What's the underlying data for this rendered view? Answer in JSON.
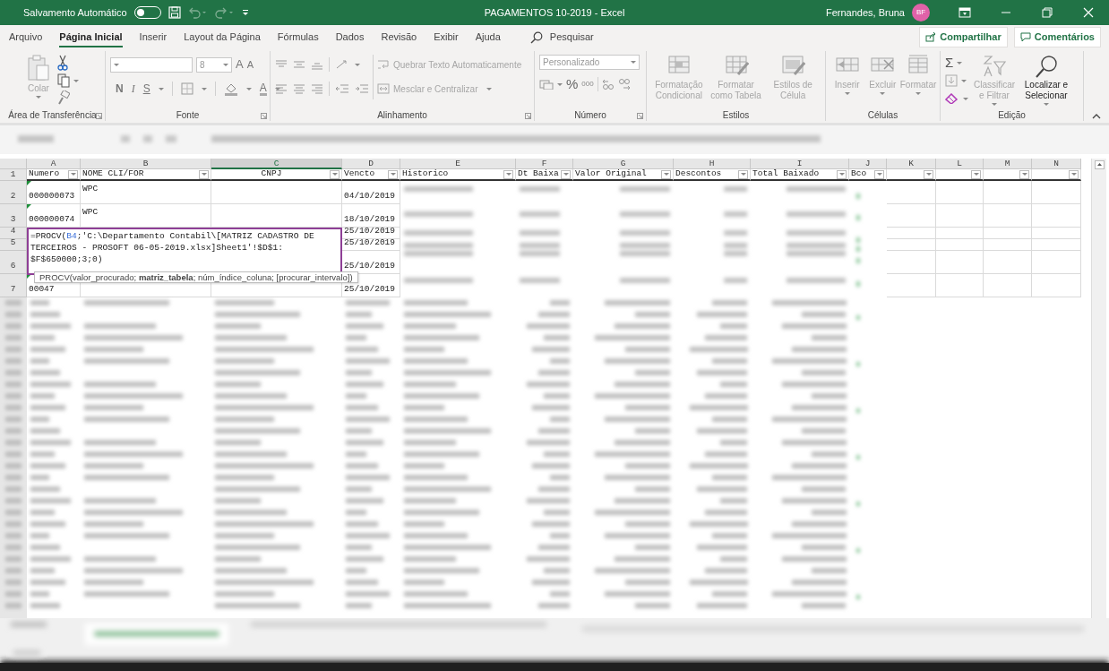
{
  "title_bar": {
    "autosave_label": "Salvamento Automático",
    "autosave_on": false,
    "document_title": "PAGAMENTOS 10-2019  -  Excel",
    "user_name": "Fernandes, Bruna",
    "user_initials": "BF"
  },
  "ribbon_tabs": [
    {
      "label": "Arquivo",
      "selected": false
    },
    {
      "label": "Página Inicial",
      "selected": true
    },
    {
      "label": "Inserir",
      "selected": false
    },
    {
      "label": "Layout da Página",
      "selected": false
    },
    {
      "label": "Fórmulas",
      "selected": false
    },
    {
      "label": "Dados",
      "selected": false
    },
    {
      "label": "Revisão",
      "selected": false
    },
    {
      "label": "Exibir",
      "selected": false
    },
    {
      "label": "Ajuda",
      "selected": false
    }
  ],
  "search_label": "Pesquisar",
  "share_button": "Compartilhar",
  "comments_button": "Comentários",
  "ribbon": {
    "clipboard": {
      "name": "Área de Transferência",
      "paste_label": "Colar"
    },
    "font": {
      "name": "Fonte",
      "font_size": "8",
      "size_glyphs": [
        "A",
        "A"
      ],
      "style_buttons": [
        "N",
        "I",
        "S"
      ],
      "color_glyph": "A"
    },
    "alignment": {
      "name": "Alinhamento",
      "wrap_label": "Quebrar Texto Automaticamente",
      "merge_label": "Mesclar e Centralizar"
    },
    "number": {
      "name": "Número",
      "format": "Personalizado",
      "percent": "%",
      "thousands": "000"
    },
    "styles": {
      "name": "Estilos",
      "buttons": [
        {
          "label": "Formatação Condicional",
          "kind": "conditional",
          "disabled": true
        },
        {
          "label": "Formatar como Tabela",
          "kind": "table",
          "disabled": true
        },
        {
          "label": "Estilos de Célula",
          "kind": "cellstyle",
          "disabled": true
        }
      ]
    },
    "cells": {
      "name": "Células",
      "buttons": [
        {
          "label": "Inserir",
          "kind": "insert",
          "disabled": true
        },
        {
          "label": "Excluir",
          "kind": "delete",
          "disabled": true
        },
        {
          "label": "Formatar",
          "kind": "format",
          "disabled": true
        }
      ]
    },
    "editing": {
      "name": "Edição",
      "sum_glyph": "Σ",
      "buttons": [
        {
          "label": "Classificar e Filtrar",
          "kind": "sort",
          "disabled": true
        },
        {
          "label": "Localizar e Selecionar",
          "kind": "find",
          "disabled": false
        }
      ]
    }
  },
  "sheet": {
    "columns": [
      {
        "letter": "A",
        "header": "Numero",
        "selected": false
      },
      {
        "letter": "B",
        "header": "NOME CLI/FOR",
        "selected": false
      },
      {
        "letter": "C",
        "header": "CNPJ",
        "selected": true
      },
      {
        "letter": "D",
        "header": "Vencto",
        "selected": false
      },
      {
        "letter": "E",
        "header": "Historico",
        "selected": false
      },
      {
        "letter": "F",
        "header": "Dt Baixa",
        "selected": false
      },
      {
        "letter": "G",
        "header": "Valor Original",
        "selected": false
      },
      {
        "letter": "H",
        "header": "Descontos",
        "selected": false
      },
      {
        "letter": "I",
        "header": "Total Baixado",
        "selected": false
      },
      {
        "letter": "J",
        "header": "Bco",
        "selected": false
      },
      {
        "letter": "K",
        "selected": false
      },
      {
        "letter": "L",
        "selected": false
      },
      {
        "letter": "M",
        "selected": false
      },
      {
        "letter": "N",
        "selected": false
      }
    ],
    "header_row_number": "1",
    "rows": [
      {
        "number": "2",
        "flagged": true,
        "cells": {
          "A": "000000073",
          "B": "WPC",
          "D": "04/10/2019"
        }
      },
      {
        "number": "3",
        "flagged": true,
        "cells": {
          "A": "000000074",
          "B": "WPC",
          "D": "18/10/2019"
        }
      },
      {
        "number": "4",
        "cells": {
          "D": "25/10/2019"
        }
      },
      {
        "number": "5",
        "cells": {
          "D": "25/10/2019"
        }
      },
      {
        "number": "6",
        "cells": {
          "D": "25/10/2019"
        }
      },
      {
        "number": "7",
        "flagged": true,
        "cells": {
          "A": "00047",
          "D": "25/10/2019"
        }
      }
    ],
    "formula_edit": {
      "lines": [
        [
          {
            "text": "=PROCV("
          },
          {
            "text": "B4",
            "kind": "ref"
          },
          {
            "text": ";'C:\\Departamento Contabil\\[MATRIZ CADASTRO DE"
          }
        ],
        [
          {
            "text": "TERCEIROS - PROSOFT 06-05-2019.xlsx]Sheet1'!$D$1:"
          }
        ],
        [
          {
            "text": "$F$650000;3;0)"
          }
        ]
      ]
    },
    "tooltip": "PROCV(valor_procurado; **matriz_tabela**; núm_índice_coluna; [procurar_intervalo])"
  }
}
